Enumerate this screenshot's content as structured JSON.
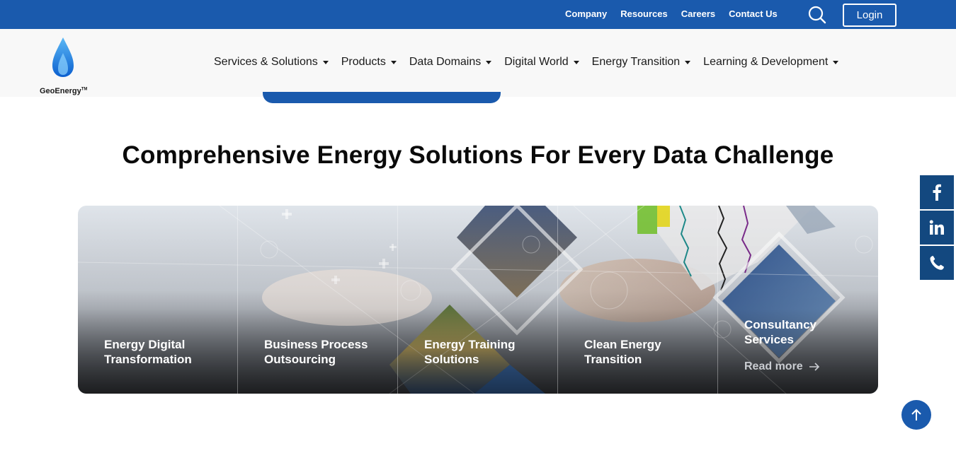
{
  "topbar": {
    "links": [
      "Company",
      "Resources",
      "Careers",
      "Contact Us"
    ],
    "login_label": "Login",
    "bg_color": "#1a5aad"
  },
  "brand": {
    "name": "GeoEnergy",
    "tm": "TM"
  },
  "nav": {
    "items": [
      "Services & Solutions",
      "Products",
      "Data Domains",
      "Digital World",
      "Energy Transition",
      "Learning & Development"
    ]
  },
  "section": {
    "heading": "Comprehensive Energy Solutions For Every Data Challenge",
    "cards": [
      {
        "title": "Energy Digital Transformation"
      },
      {
        "title": "Business Process Outsourcing"
      },
      {
        "title": "Energy Training Solutions"
      },
      {
        "title": "Clean Energy Transition"
      },
      {
        "title": "Consultancy Services",
        "more": "Read more"
      }
    ]
  },
  "social": {
    "icons": [
      "facebook-icon",
      "linkedin-icon",
      "phone-icon"
    ],
    "bg_color": "#13487f"
  },
  "icons": {
    "search": "search-icon",
    "scroll_top": "arrow-up-icon"
  }
}
